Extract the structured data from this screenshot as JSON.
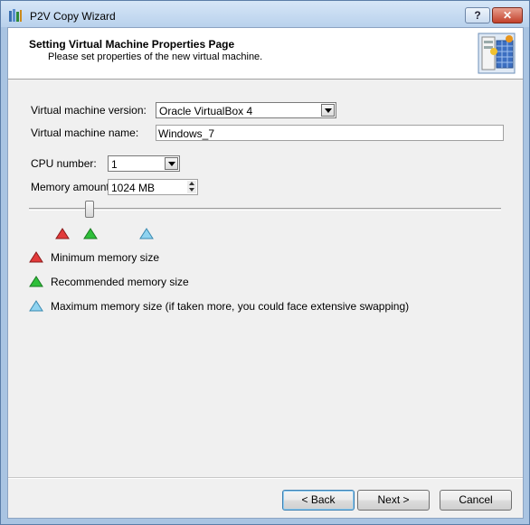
{
  "window": {
    "title": "P2V Copy Wizard",
    "help_label": "?",
    "close_label": "✕"
  },
  "header": {
    "title": "Setting Virtual Machine Properties Page",
    "subtitle": "Please set properties of the new virtual machine."
  },
  "form": {
    "vm_version": {
      "label": "Virtual machine version:",
      "value": "Oracle VirtualBox 4"
    },
    "vm_name": {
      "label": "Virtual machine name:",
      "value": "Windows_7"
    },
    "cpu": {
      "label": "CPU number:",
      "value": "1"
    },
    "memory": {
      "label": "Memory amount:",
      "value": "1024 MB"
    }
  },
  "legend": {
    "min": {
      "label": "Minimum memory size",
      "color": "#e23a3a"
    },
    "recommended": {
      "label": "Recommended memory size",
      "color": "#2fbf3a"
    },
    "max": {
      "label": "Maximum memory size (if taken more, you could face extensive swapping)",
      "color": "#8fd3f0"
    }
  },
  "buttons": {
    "back": "< Back",
    "next": "Next >",
    "cancel": "Cancel"
  }
}
